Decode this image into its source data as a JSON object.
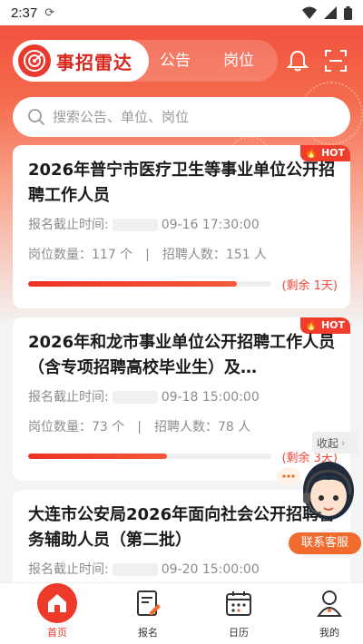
{
  "status_bar": {
    "time": "2:37"
  },
  "header": {
    "app_name": "事招雷达",
    "tabs": [
      {
        "label": "公告"
      },
      {
        "label": "岗位"
      }
    ]
  },
  "search": {
    "placeholder": "搜索公告、单位、岗位"
  },
  "cards": [
    {
      "hot": "HOT",
      "title": "2026年普宁市医疗卫生等事业单位公开招聘工作人员",
      "deadline_label": "报名截止时间:",
      "deadline": "09-16 17:30:00",
      "positions": "岗位数量：117 个",
      "separator": "|",
      "hires": "招聘人数：151 人",
      "remaining": "(剩余 1天)",
      "progress": 0.86
    },
    {
      "hot": "HOT",
      "title": "2026年和龙市事业单位公开招聘工作人员（含专项招聘高校毕业生）及…",
      "deadline_label": "报名截止时间:",
      "deadline": "09-18 15:00:00",
      "positions": "岗位数量：73 个",
      "separator": "|",
      "hires": "招聘人数：78 人",
      "remaining": "(剩余 3天)",
      "progress": 0.57
    },
    {
      "title": "大连市公安局2026年面向社会公开招聘警务辅助人员（第二批）",
      "deadline_label": "报名截止时间:",
      "deadline": "09-20 15:00:00"
    }
  ],
  "collapse_label": "收起",
  "service_label": "联系客服",
  "tabbar": [
    {
      "label": "首页",
      "icon": "home-icon"
    },
    {
      "label": "报名",
      "icon": "signup-icon"
    },
    {
      "label": "日历",
      "icon": "calendar-icon"
    },
    {
      "label": "我的",
      "icon": "profile-icon"
    }
  ],
  "colors": {
    "accent": "#e8392c",
    "hero": "#f04a3a",
    "service": "#f26b2e"
  }
}
